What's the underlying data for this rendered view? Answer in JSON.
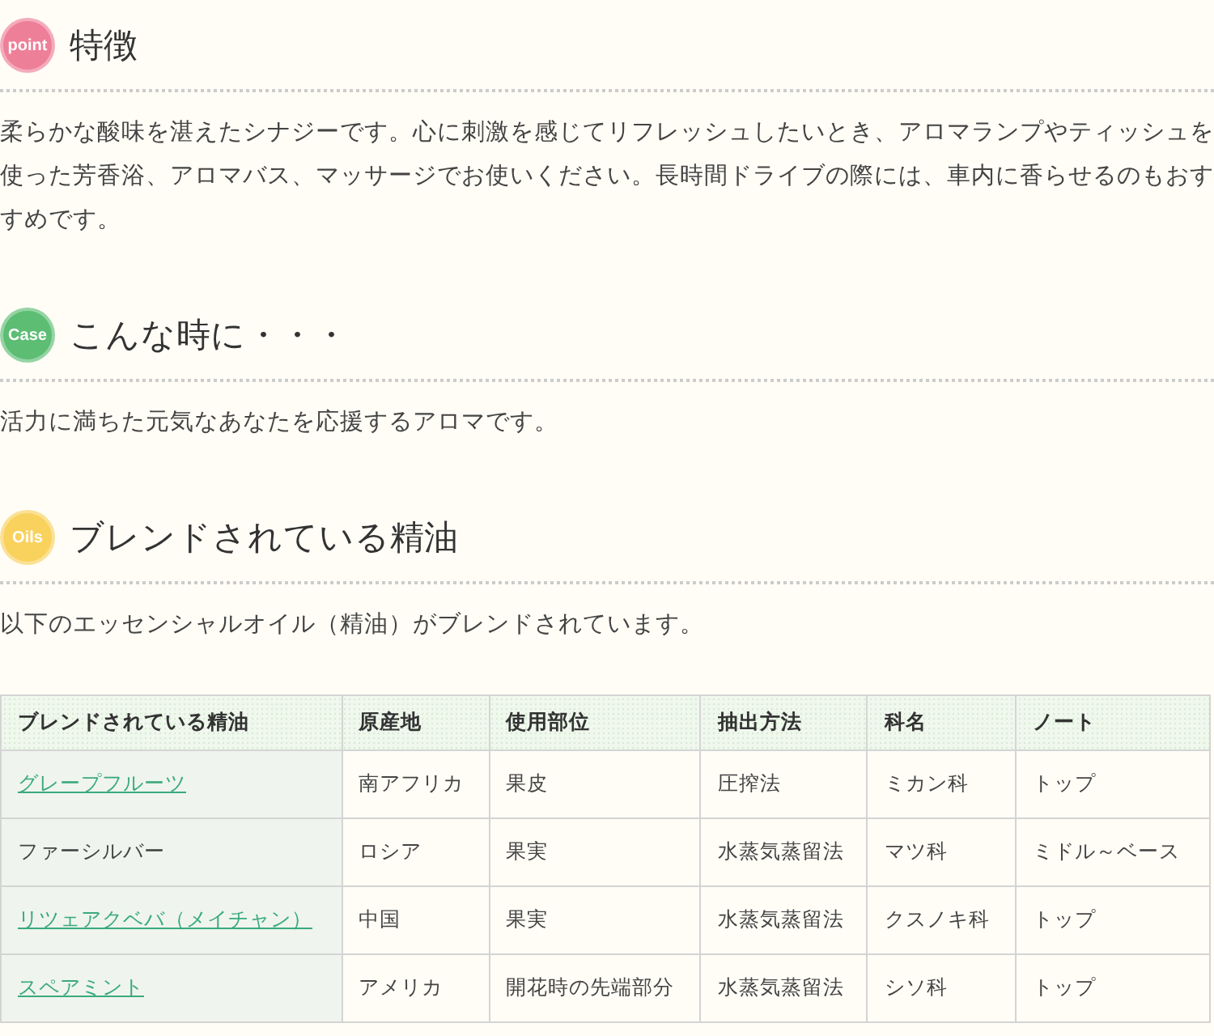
{
  "sections": [
    {
      "badge": "point",
      "color": "#ee7f98",
      "heading": "特徴",
      "text": "柔らかな酸味を湛えたシナジーです。心に刺激を感じてリフレッシュしたいとき、アロマランプやティッシュを使った芳香浴、アロマバス、マッサージでお使いください。長時間ドライブの際には、車内に香らせるのもおすすめです。"
    },
    {
      "badge": "Case",
      "color": "#5cbd73",
      "heading": "こんな時に・・・",
      "text": "活力に満ちた元気なあなたを応援するアロマです。"
    },
    {
      "badge": "Oils",
      "color": "#f9d25e",
      "heading": "ブレンドされている精油",
      "text": "以下のエッセンシャルオイル（精油）がブレンドされています。"
    }
  ],
  "table": {
    "columns": [
      "ブレンドされている精油",
      "原産地",
      "使用部位",
      "抽出方法",
      "科名",
      "ノート"
    ],
    "rows": [
      {
        "kind": "link",
        "cells": [
          "グレープフルーツ",
          "南アフリカ",
          "果皮",
          "圧搾法",
          "ミカン科",
          "トップ"
        ]
      },
      {
        "kind": "plain",
        "cells": [
          "ファーシルバー",
          "ロシア",
          "果実",
          "水蒸気蒸留法",
          "マツ科",
          "ミドル～ベース"
        ]
      },
      {
        "kind": "link",
        "cells": [
          "リツェアクベバ（メイチャン）",
          "中国",
          "果実",
          "水蒸気蒸留法",
          "クスノキ科",
          "トップ"
        ]
      },
      {
        "kind": "link",
        "cells": [
          "スペアミント",
          "アメリカ",
          "開花時の先端部分",
          "水蒸気蒸留法",
          "シソ科",
          "トップ"
        ]
      }
    ]
  }
}
